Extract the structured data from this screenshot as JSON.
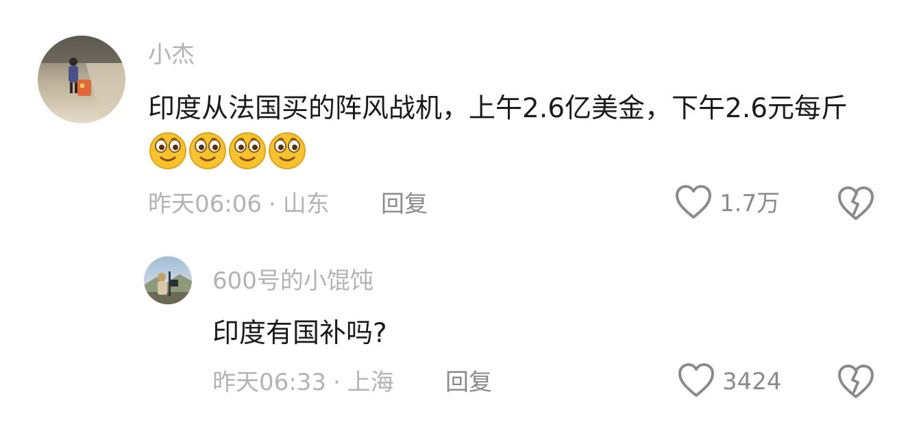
{
  "comment": {
    "username": "小杰",
    "text": "印度从法国买的阵风战机，上午2.6亿美金，下午2.6元每斤",
    "emoji_count": 4,
    "emoji_icon": "smile-emoji-icon",
    "time": "昨天06:06",
    "separator": "·",
    "location": "山东",
    "reply_label": "回复",
    "like_count": "1.7万"
  },
  "reply": {
    "username": "600号的小馄饨",
    "text": "印度有国补吗?",
    "time": "昨天06:33",
    "separator": "·",
    "location": "上海",
    "reply_label": "回复",
    "like_count": "3424"
  },
  "colors": {
    "text_primary": "#1a1a1a",
    "text_secondary": "#b3b3b3",
    "text_action": "#8a8a8a",
    "emoji_yellow": "#f6c22e"
  }
}
